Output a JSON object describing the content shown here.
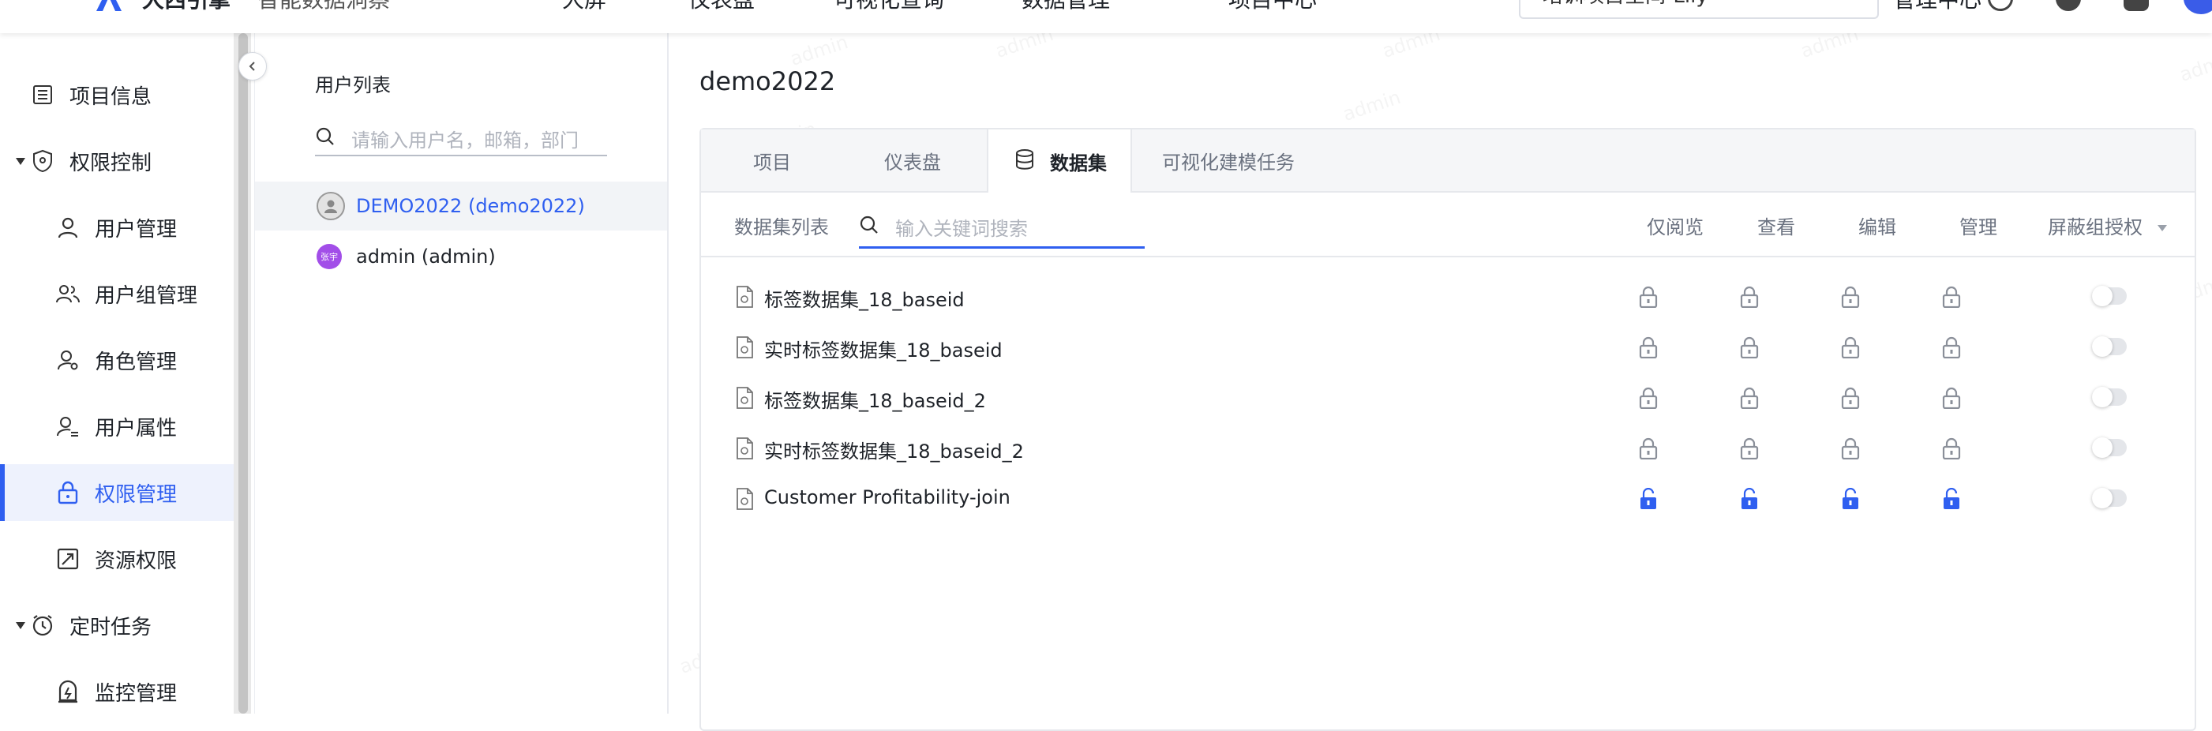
{
  "topbar": {
    "brand": "大西引擎",
    "project": "智能数据洞察",
    "nav": [
      "大屏",
      "仪表盘",
      "可视化查询",
      "数据管理",
      "项目中心"
    ],
    "project_selector": "培训项目空间-Lily",
    "admin_center": "管理中心"
  },
  "sidebar": {
    "items": [
      {
        "label": "项目信息",
        "icon": "list-icon"
      },
      {
        "label": "权限控制",
        "icon": "shield-icon",
        "group": true
      },
      {
        "label": "用户管理",
        "icon": "user-icon"
      },
      {
        "label": "用户组管理",
        "icon": "user-group-icon"
      },
      {
        "label": "角色管理",
        "icon": "role-icon"
      },
      {
        "label": "用户属性",
        "icon": "user-attribute-icon"
      },
      {
        "label": "权限管理",
        "icon": "lock-icon",
        "active": true
      },
      {
        "label": "资源权限",
        "icon": "resource-icon"
      },
      {
        "label": "定时任务",
        "icon": "clock-icon",
        "group": true
      },
      {
        "label": "监控管理",
        "icon": "monitor-icon"
      }
    ]
  },
  "users": {
    "title": "用户列表",
    "search_placeholder": "请输入用户名，邮箱，部门",
    "list": [
      {
        "name": "DEMO2022 (demo2022)",
        "selected": true,
        "avatar_text": ""
      },
      {
        "name": "admin (admin)",
        "selected": false,
        "avatar_text": "张宇"
      }
    ]
  },
  "main": {
    "title": "demo2022",
    "tabs": [
      {
        "label": "项目",
        "active": false
      },
      {
        "label": "仪表盘",
        "active": false
      },
      {
        "label": "数据集",
        "active": true
      },
      {
        "label": "可视化建模任务",
        "active": false
      }
    ],
    "dataset_list_label": "数据集列表",
    "search_placeholder": "输入关键词搜索",
    "columns": [
      "仅阅览",
      "查看",
      "编辑",
      "管理",
      "屏蔽组授权"
    ],
    "datasets": [
      {
        "name": "标签数据集_18_baseid",
        "unlocked": false
      },
      {
        "name": "实时标签数据集_18_baseid",
        "unlocked": false
      },
      {
        "name": "标签数据集_18_baseid_2",
        "unlocked": false
      },
      {
        "name": "实时标签数据集_18_baseid_2",
        "unlocked": false
      },
      {
        "name": "Customer Profitability-join",
        "unlocked": true
      }
    ]
  },
  "watermark": "admin",
  "colors": {
    "accent": "#2f5ff0",
    "active_bg": "#eef2fd",
    "locked_icon": "#8a8f99",
    "toggle_off": "#e4e6ea"
  }
}
